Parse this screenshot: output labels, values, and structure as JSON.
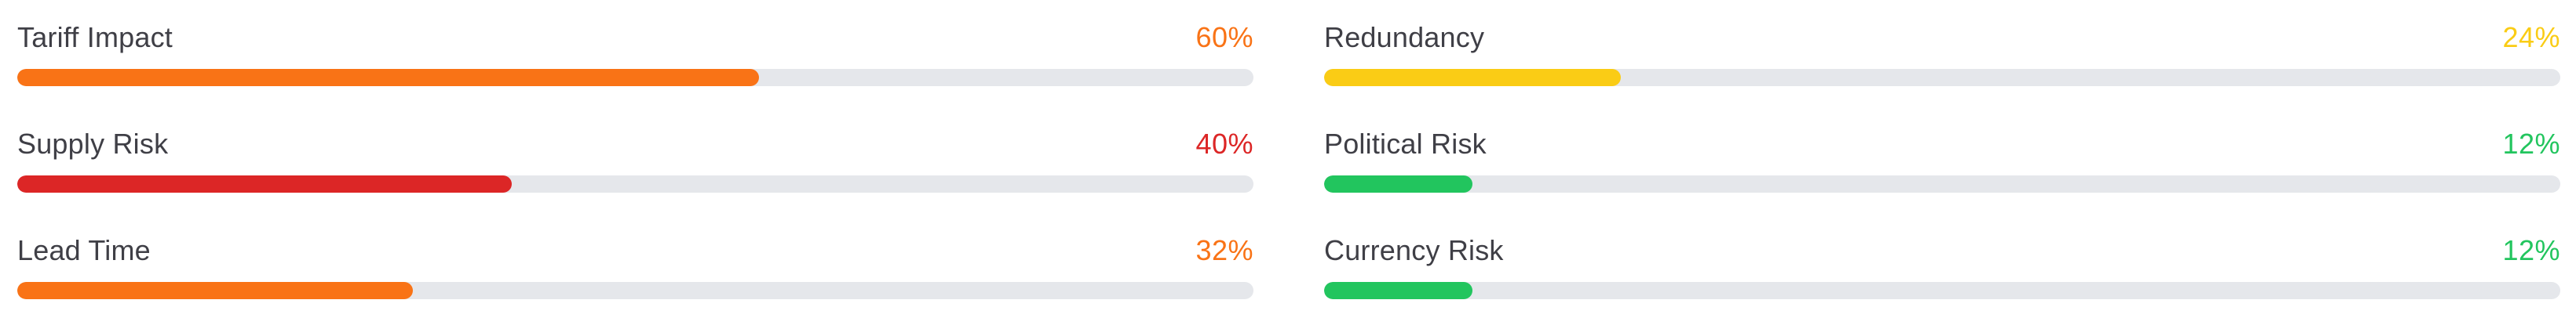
{
  "metrics": [
    {
      "label": "Tariff Impact",
      "value": "60%",
      "level": 0.6,
      "color": "#f97316"
    },
    {
      "label": "Redundancy",
      "value": "24%",
      "level": 0.24,
      "color": "#facc15"
    },
    {
      "label": "Supply Risk",
      "value": "40%",
      "level": 0.4,
      "color": "#dc2626"
    },
    {
      "label": "Political Risk",
      "value": "12%",
      "level": 0.12,
      "color": "#22c55e"
    },
    {
      "label": "Lead Time",
      "value": "32%",
      "level": 0.32,
      "color": "#f97316"
    },
    {
      "label": "Currency Risk",
      "value": "12%",
      "level": 0.12,
      "color": "#22c55e"
    }
  ]
}
